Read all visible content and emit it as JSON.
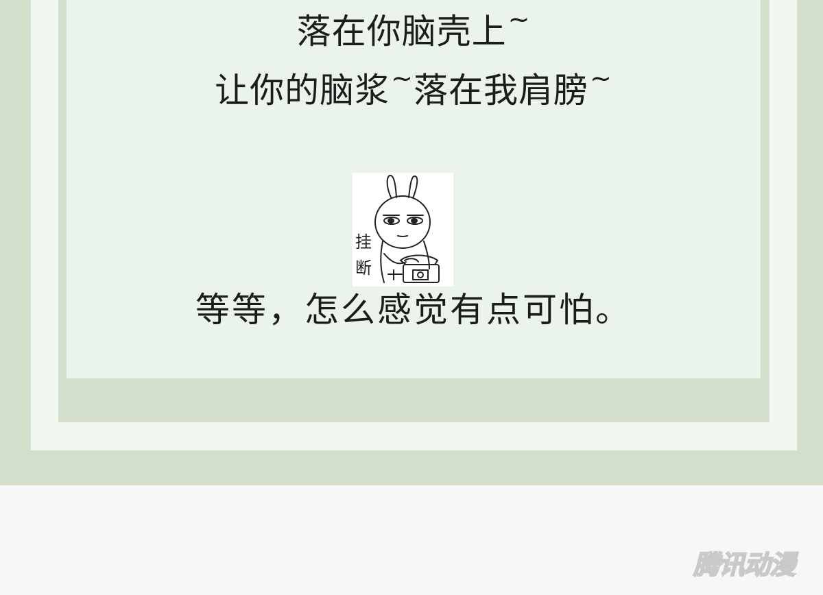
{
  "comic": {
    "line1": "落在你脑壳上",
    "line1_tilde": "~",
    "line2_a": "让你的脑浆",
    "line2_tilde_a": "~",
    "line2_b": "落在我肩膀",
    "line2_tilde_b": "~",
    "line3": "等等，怎么感觉有点可怕。"
  },
  "sticker": {
    "description_icon": "rabbit-hangup-sticker",
    "text_top": "挂",
    "text_bottom": "断"
  },
  "watermark": {
    "text": "腾讯动漫"
  },
  "colors": {
    "outer_frame": "#d3dfca",
    "inner_border": "#f1f7f1",
    "panel": "#eaf4eb",
    "page_bg": "#f7f7f7",
    "text": "#1c1c1c"
  }
}
